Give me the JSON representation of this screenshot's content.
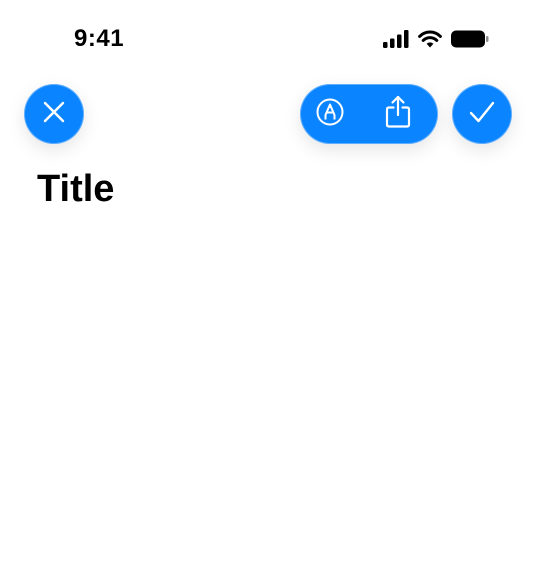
{
  "status_bar": {
    "time": "9:41",
    "icons": [
      "cellular-signal-icon",
      "wifi-icon",
      "battery-icon"
    ]
  },
  "toolbar": {
    "close": {
      "icon": "close-icon"
    },
    "actions": [
      {
        "icon": "markup-icon"
      },
      {
        "icon": "share-icon"
      }
    ],
    "confirm": {
      "icon": "checkmark-icon"
    }
  },
  "page": {
    "title": "Title"
  },
  "colors": {
    "accent": "#0a84ff",
    "text": "#000000",
    "background": "#ffffff"
  }
}
